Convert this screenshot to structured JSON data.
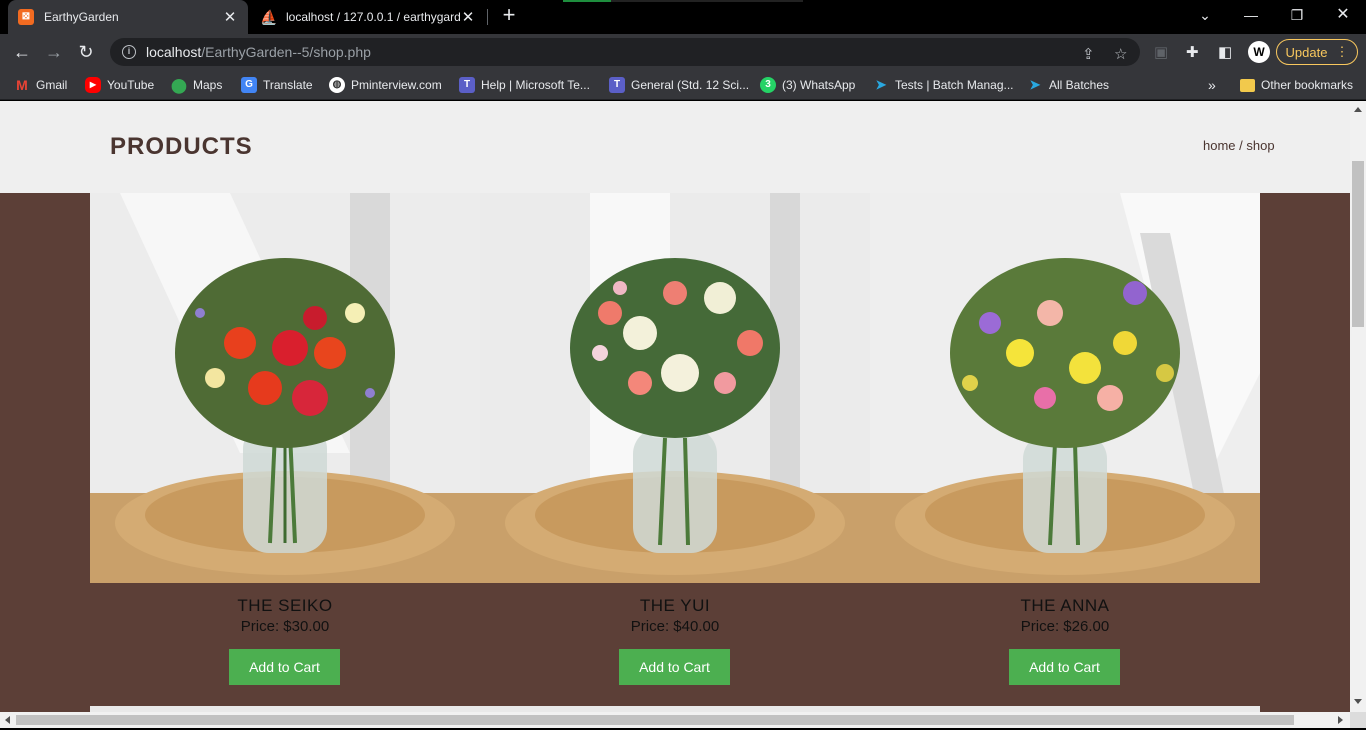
{
  "browser": {
    "tabs": [
      {
        "title": "EarthyGarden",
        "active": true
      },
      {
        "title": "localhost / 127.0.0.1 / earthygard",
        "active": false
      }
    ],
    "address": {
      "host": "localhost",
      "path": "/EarthyGarden--5/shop.php"
    },
    "update_label": "Update",
    "bookmarks": [
      {
        "label": "Gmail",
        "icon": "gmail-icon"
      },
      {
        "label": "YouTube",
        "icon": "youtube-icon"
      },
      {
        "label": "Maps",
        "icon": "maps-icon"
      },
      {
        "label": "Translate",
        "icon": "translate-icon"
      },
      {
        "label": "Pminterview.com",
        "icon": "globe-icon"
      },
      {
        "label": "Help | Microsoft Te...",
        "icon": "teams-icon"
      },
      {
        "label": "General (Std. 12 Sci...",
        "icon": "teams-icon"
      },
      {
        "label": "(3) WhatsApp",
        "icon": "whatsapp-icon"
      },
      {
        "label": "Tests | Batch Manag...",
        "icon": "batch-icon"
      },
      {
        "label": "All Batches",
        "icon": "batch-icon"
      }
    ],
    "other_bookmarks": "Other bookmarks",
    "overflow": "»"
  },
  "page": {
    "title": "PRODUCTS",
    "breadcrumb": "home / shop",
    "products": [
      {
        "name": "THE SEIKO",
        "price": "Price: $30.00",
        "button": "Add to Cart"
      },
      {
        "name": "THE YUI",
        "price": "Price: $40.00",
        "button": "Add to Cart"
      },
      {
        "name": "THE ANNA",
        "price": "Price: $26.00",
        "button": "Add to Cart"
      }
    ]
  },
  "colors": {
    "page_bg": "#5c3f37",
    "header_bg": "#efefef",
    "title_text": "#4a3530",
    "cart_button": "#4caf50",
    "update_accent": "#f9c85e"
  }
}
